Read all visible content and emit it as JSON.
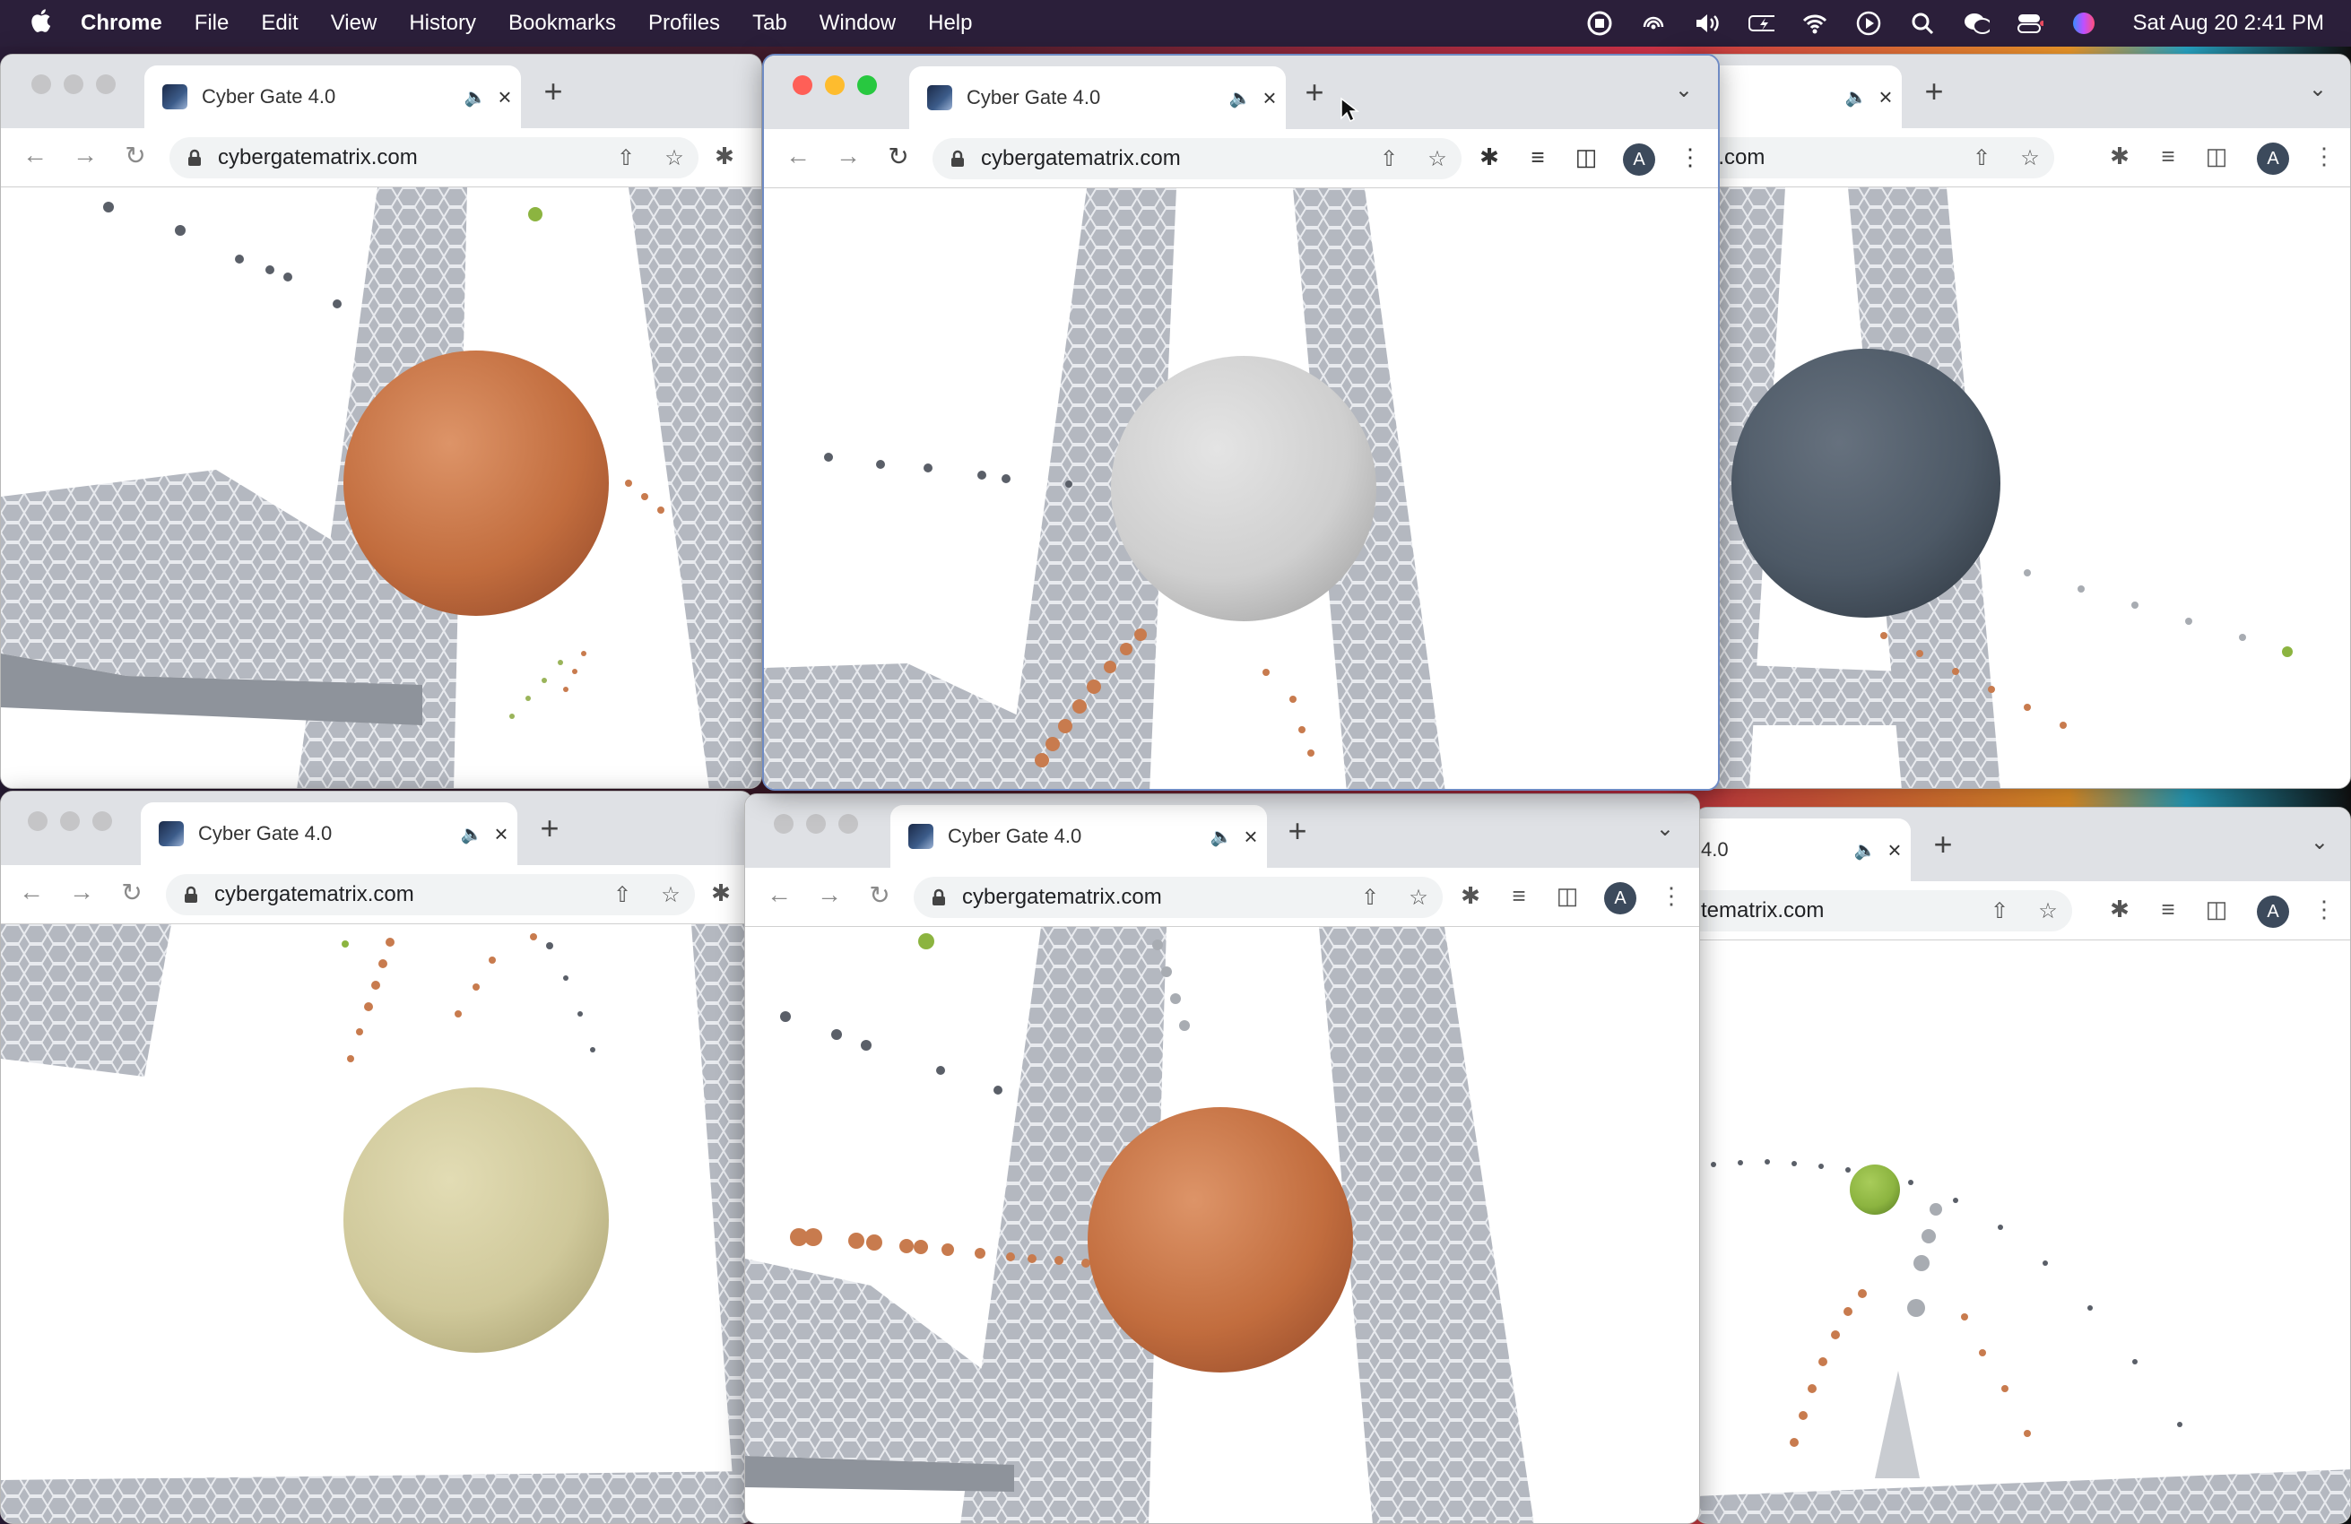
{
  "menubar": {
    "apple_icon": "apple-logo",
    "app_name": "Chrome",
    "menus": [
      "File",
      "Edit",
      "View",
      "History",
      "Bookmarks",
      "Profiles",
      "Tab",
      "Window",
      "Help"
    ],
    "status_icons": [
      "screen-record-icon",
      "airdrop-icon",
      "volume-icon",
      "battery-icon",
      "wifi-icon",
      "play-icon",
      "search-icon",
      "wechat-icon",
      "control-center-icon",
      "siri-icon"
    ],
    "clock": "Sat Aug 20  2:41 PM"
  },
  "tab": {
    "title": "Cyber Gate 4.0",
    "title_partial": "4.0"
  },
  "address": {
    "url": "cybergatematrix.com",
    "url_partial_a": "atrix.com",
    "url_partial_b": "tematrix.com"
  },
  "profile_initial": "A",
  "scenes": [
    {
      "window": "top-left",
      "sphere": "orange",
      "sphere_color": "#c87b4e"
    },
    {
      "window": "top-center",
      "sphere": "silver",
      "sphere_color": "#cfcfcf"
    },
    {
      "window": "top-right",
      "sphere": "slate",
      "sphere_color": "#4d5966"
    },
    {
      "window": "bottom-left",
      "sphere": "khaki",
      "sphere_color": "#cfc89a"
    },
    {
      "window": "bottom-center",
      "sphere": "orange",
      "sphere_color": "#c87b4e"
    },
    {
      "window": "bottom-right",
      "sphere": "green",
      "sphere_color": "#8cb440"
    }
  ],
  "colors": {
    "accent_red": "#ff5f57",
    "accent_yellow": "#febc2e",
    "accent_green": "#28c840",
    "tabstrip": "#dfe1e5",
    "pillar": "#a9adb5"
  }
}
